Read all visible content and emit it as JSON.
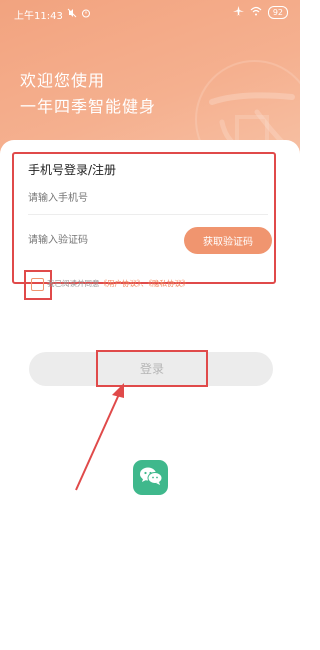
{
  "status_bar": {
    "time": "上午11:43",
    "battery": "92"
  },
  "welcome": {
    "line1": "欢迎您使用",
    "line2": "一年四季智能健身"
  },
  "login_form": {
    "title": "手机号登录/注册",
    "phone_placeholder": "请输入手机号",
    "code_placeholder": "请输入验证码",
    "get_code_label": "获取验证码"
  },
  "agreement": {
    "prefix": "我已阅读并同意",
    "user_agreement": "《用户协议》",
    "separator": "、",
    "privacy_agreement": "《隐私协议》"
  },
  "login_button": {
    "label": "登录"
  },
  "colors": {
    "accent": "#f0956f",
    "header_gradient_start": "#f2a37f",
    "annotation_red": "#e04a4a",
    "wechat_green": "#3fb88c"
  },
  "icons": [
    "mute-icon",
    "alarm-icon",
    "airplane-icon",
    "wifi-icon",
    "battery-icon",
    "wechat-icon"
  ]
}
